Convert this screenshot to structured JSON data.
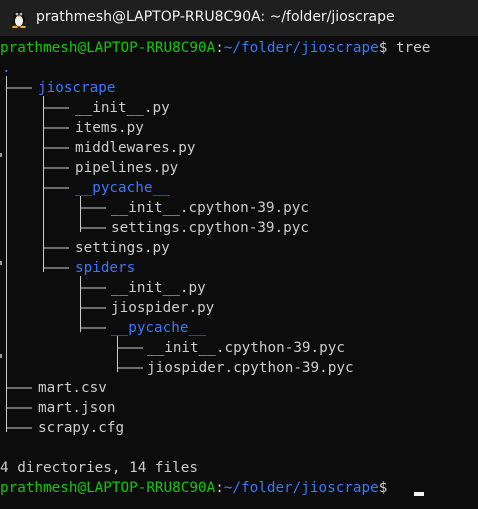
{
  "window": {
    "title": "prathmesh@LAPTOP-RRU8C90A: ~/folder/jioscrape",
    "icon": "linux-tux-icon"
  },
  "prompt": {
    "user_host": "prathmesh@LAPTOP-RRU8C90A",
    "separator": ":",
    "path": "~/folder/jioscrape",
    "symbol": "$",
    "command": " tree"
  },
  "tree": {
    "root": ".",
    "entries": [
      {
        "name": "jioscrape",
        "type": "dir"
      },
      {
        "name": "__init__.py",
        "type": "file"
      },
      {
        "name": "items.py",
        "type": "file"
      },
      {
        "name": "middlewares.py",
        "type": "file"
      },
      {
        "name": "pipelines.py",
        "type": "file"
      },
      {
        "name": "__pycache__",
        "type": "dir"
      },
      {
        "name": "__init__.cpython-39.pyc",
        "type": "file"
      },
      {
        "name": "settings.cpython-39.pyc",
        "type": "file"
      },
      {
        "name": "settings.py",
        "type": "file"
      },
      {
        "name": "spiders",
        "type": "dir"
      },
      {
        "name": "__init__.py",
        "type": "file"
      },
      {
        "name": "jiospider.py",
        "type": "file"
      },
      {
        "name": "__pycache__",
        "type": "dir"
      },
      {
        "name": "__init__.cpython-39.pyc",
        "type": "file"
      },
      {
        "name": "jiospider.cpython-39.pyc",
        "type": "file"
      },
      {
        "name": "mart.csv",
        "type": "file"
      },
      {
        "name": "mart.json",
        "type": "file"
      },
      {
        "name": "scrapy.cfg",
        "type": "file"
      }
    ],
    "summary": "4 directories, 14 files"
  },
  "prompt2": {
    "user_host": "prathmesh@LAPTOP-RRU8C90A",
    "separator": ":",
    "path": "~/folder/jioscrape",
    "symbol": "$"
  },
  "colors": {
    "background": "#0c0c0c",
    "user_host": "#16c60c",
    "path": "#3b78ff",
    "text": "#cccccc"
  }
}
